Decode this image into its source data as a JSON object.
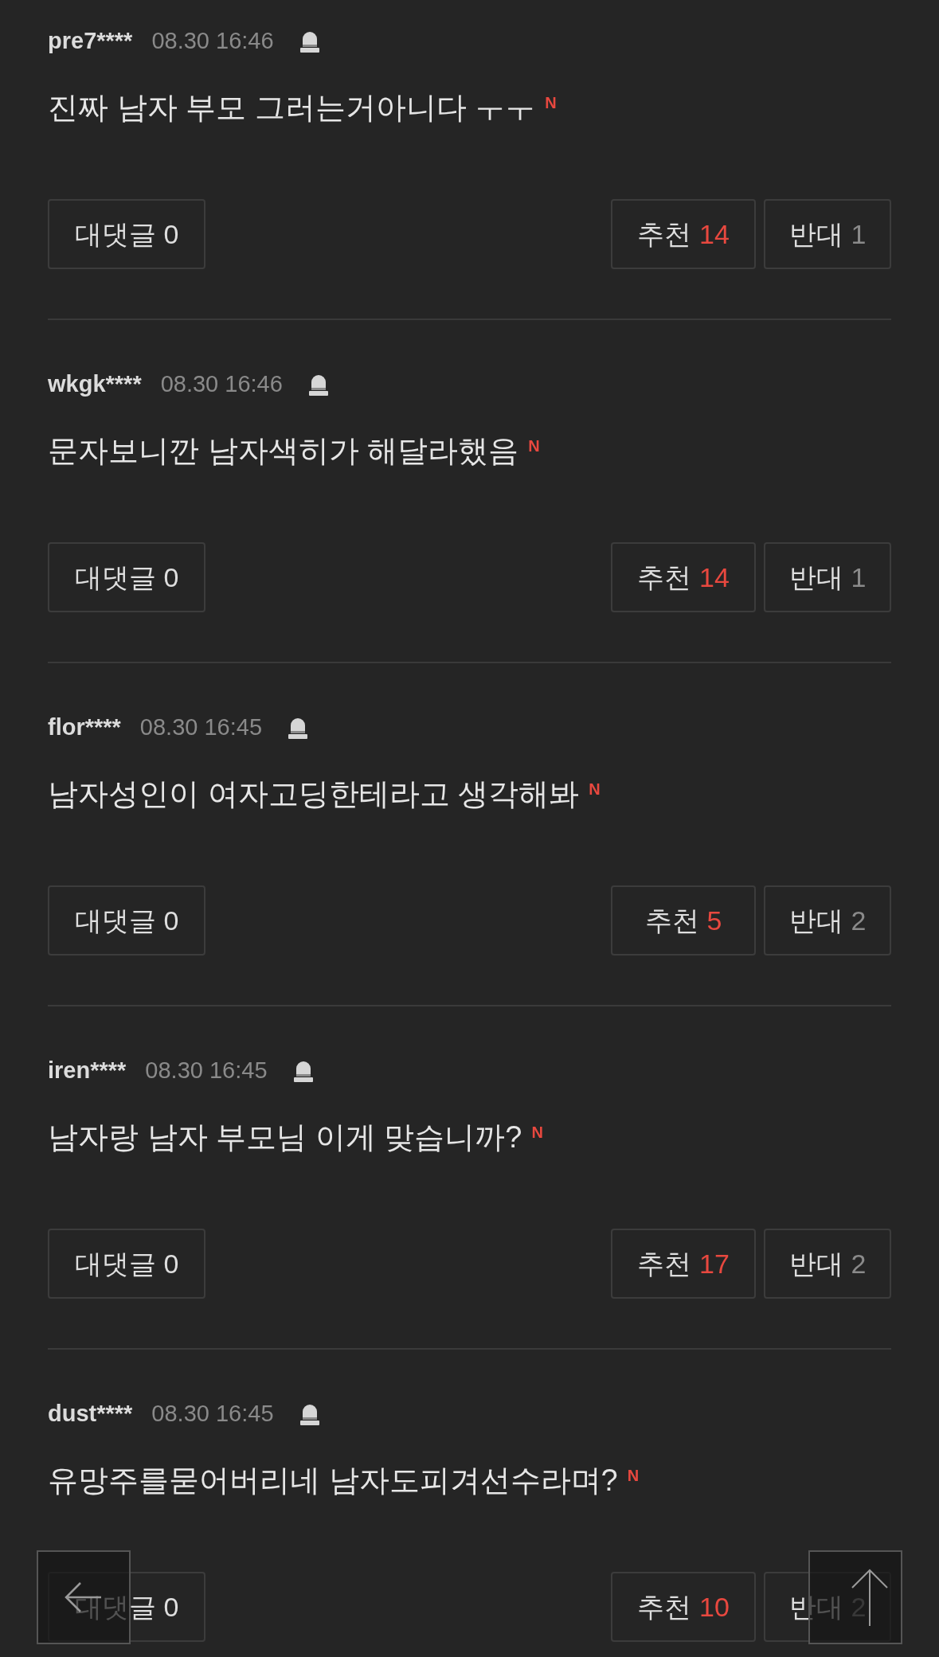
{
  "comments": [
    {
      "user": "pre7****",
      "time": "08.30 16:46",
      "text": "진짜 남자 부모 그러는거아니다 ㅜㅜ",
      "badge": "N",
      "reply": {
        "label": "대댓글",
        "count": "0"
      },
      "up": {
        "label": "추천",
        "count": "14"
      },
      "down": {
        "label": "반대",
        "count": "1"
      }
    },
    {
      "user": "wkgk****",
      "time": "08.30 16:46",
      "text": "문자보니깐 남자색히가 해달라했음",
      "badge": "N",
      "reply": {
        "label": "대댓글",
        "count": "0"
      },
      "up": {
        "label": "추천",
        "count": "14"
      },
      "down": {
        "label": "반대",
        "count": "1"
      }
    },
    {
      "user": "flor****",
      "time": "08.30 16:45",
      "text": "남자성인이 여자고딩한테라고 생각해봐",
      "badge": "N",
      "reply": {
        "label": "대댓글",
        "count": "0"
      },
      "up": {
        "label": "추천",
        "count": "5"
      },
      "down": {
        "label": "반대",
        "count": "2"
      }
    },
    {
      "user": "iren****",
      "time": "08.30 16:45",
      "text": "남자랑 남자 부모님 이게 맞습니까?",
      "badge": "N",
      "reply": {
        "label": "대댓글",
        "count": "0"
      },
      "up": {
        "label": "추천",
        "count": "17"
      },
      "down": {
        "label": "반대",
        "count": "2"
      }
    },
    {
      "user": "dust****",
      "time": "08.30 16:45",
      "text": "유망주를묻어버리네 남자도피겨선수라며?",
      "badge": "N",
      "reply": {
        "label": "대댓글",
        "count": "0"
      },
      "up": {
        "label": "추천",
        "count": "10"
      },
      "down": {
        "label": "반대",
        "count": "2"
      }
    }
  ]
}
